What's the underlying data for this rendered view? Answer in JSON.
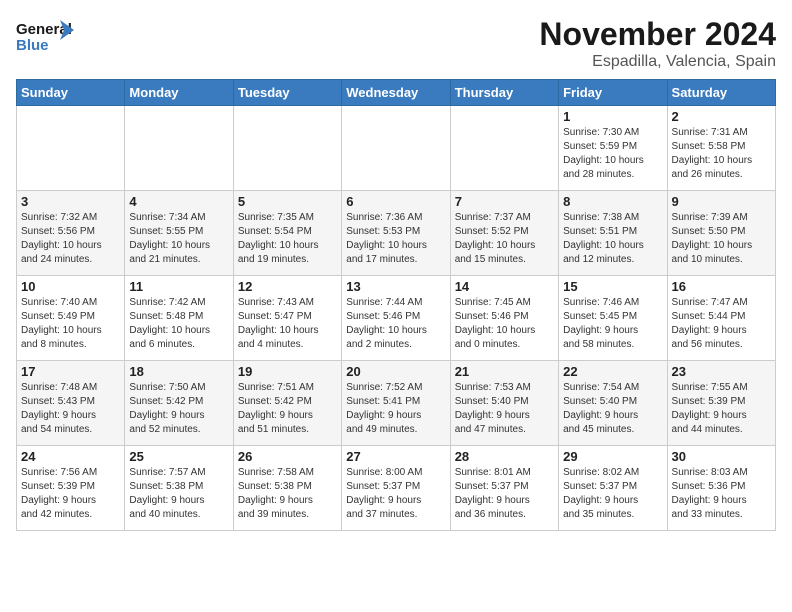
{
  "logo": {
    "line1": "General",
    "line2": "Blue"
  },
  "title": "November 2024",
  "subtitle": "Espadilla, Valencia, Spain",
  "headers": [
    "Sunday",
    "Monday",
    "Tuesday",
    "Wednesday",
    "Thursday",
    "Friday",
    "Saturday"
  ],
  "weeks": [
    [
      {
        "day": "",
        "info": ""
      },
      {
        "day": "",
        "info": ""
      },
      {
        "day": "",
        "info": ""
      },
      {
        "day": "",
        "info": ""
      },
      {
        "day": "",
        "info": ""
      },
      {
        "day": "1",
        "info": "Sunrise: 7:30 AM\nSunset: 5:59 PM\nDaylight: 10 hours\nand 28 minutes."
      },
      {
        "day": "2",
        "info": "Sunrise: 7:31 AM\nSunset: 5:58 PM\nDaylight: 10 hours\nand 26 minutes."
      }
    ],
    [
      {
        "day": "3",
        "info": "Sunrise: 7:32 AM\nSunset: 5:56 PM\nDaylight: 10 hours\nand 24 minutes."
      },
      {
        "day": "4",
        "info": "Sunrise: 7:34 AM\nSunset: 5:55 PM\nDaylight: 10 hours\nand 21 minutes."
      },
      {
        "day": "5",
        "info": "Sunrise: 7:35 AM\nSunset: 5:54 PM\nDaylight: 10 hours\nand 19 minutes."
      },
      {
        "day": "6",
        "info": "Sunrise: 7:36 AM\nSunset: 5:53 PM\nDaylight: 10 hours\nand 17 minutes."
      },
      {
        "day": "7",
        "info": "Sunrise: 7:37 AM\nSunset: 5:52 PM\nDaylight: 10 hours\nand 15 minutes."
      },
      {
        "day": "8",
        "info": "Sunrise: 7:38 AM\nSunset: 5:51 PM\nDaylight: 10 hours\nand 12 minutes."
      },
      {
        "day": "9",
        "info": "Sunrise: 7:39 AM\nSunset: 5:50 PM\nDaylight: 10 hours\nand 10 minutes."
      }
    ],
    [
      {
        "day": "10",
        "info": "Sunrise: 7:40 AM\nSunset: 5:49 PM\nDaylight: 10 hours\nand 8 minutes."
      },
      {
        "day": "11",
        "info": "Sunrise: 7:42 AM\nSunset: 5:48 PM\nDaylight: 10 hours\nand 6 minutes."
      },
      {
        "day": "12",
        "info": "Sunrise: 7:43 AM\nSunset: 5:47 PM\nDaylight: 10 hours\nand 4 minutes."
      },
      {
        "day": "13",
        "info": "Sunrise: 7:44 AM\nSunset: 5:46 PM\nDaylight: 10 hours\nand 2 minutes."
      },
      {
        "day": "14",
        "info": "Sunrise: 7:45 AM\nSunset: 5:46 PM\nDaylight: 10 hours\nand 0 minutes."
      },
      {
        "day": "15",
        "info": "Sunrise: 7:46 AM\nSunset: 5:45 PM\nDaylight: 9 hours\nand 58 minutes."
      },
      {
        "day": "16",
        "info": "Sunrise: 7:47 AM\nSunset: 5:44 PM\nDaylight: 9 hours\nand 56 minutes."
      }
    ],
    [
      {
        "day": "17",
        "info": "Sunrise: 7:48 AM\nSunset: 5:43 PM\nDaylight: 9 hours\nand 54 minutes."
      },
      {
        "day": "18",
        "info": "Sunrise: 7:50 AM\nSunset: 5:42 PM\nDaylight: 9 hours\nand 52 minutes."
      },
      {
        "day": "19",
        "info": "Sunrise: 7:51 AM\nSunset: 5:42 PM\nDaylight: 9 hours\nand 51 minutes."
      },
      {
        "day": "20",
        "info": "Sunrise: 7:52 AM\nSunset: 5:41 PM\nDaylight: 9 hours\nand 49 minutes."
      },
      {
        "day": "21",
        "info": "Sunrise: 7:53 AM\nSunset: 5:40 PM\nDaylight: 9 hours\nand 47 minutes."
      },
      {
        "day": "22",
        "info": "Sunrise: 7:54 AM\nSunset: 5:40 PM\nDaylight: 9 hours\nand 45 minutes."
      },
      {
        "day": "23",
        "info": "Sunrise: 7:55 AM\nSunset: 5:39 PM\nDaylight: 9 hours\nand 44 minutes."
      }
    ],
    [
      {
        "day": "24",
        "info": "Sunrise: 7:56 AM\nSunset: 5:39 PM\nDaylight: 9 hours\nand 42 minutes."
      },
      {
        "day": "25",
        "info": "Sunrise: 7:57 AM\nSunset: 5:38 PM\nDaylight: 9 hours\nand 40 minutes."
      },
      {
        "day": "26",
        "info": "Sunrise: 7:58 AM\nSunset: 5:38 PM\nDaylight: 9 hours\nand 39 minutes."
      },
      {
        "day": "27",
        "info": "Sunrise: 8:00 AM\nSunset: 5:37 PM\nDaylight: 9 hours\nand 37 minutes."
      },
      {
        "day": "28",
        "info": "Sunrise: 8:01 AM\nSunset: 5:37 PM\nDaylight: 9 hours\nand 36 minutes."
      },
      {
        "day": "29",
        "info": "Sunrise: 8:02 AM\nSunset: 5:37 PM\nDaylight: 9 hours\nand 35 minutes."
      },
      {
        "day": "30",
        "info": "Sunrise: 8:03 AM\nSunset: 5:36 PM\nDaylight: 9 hours\nand 33 minutes."
      }
    ]
  ]
}
